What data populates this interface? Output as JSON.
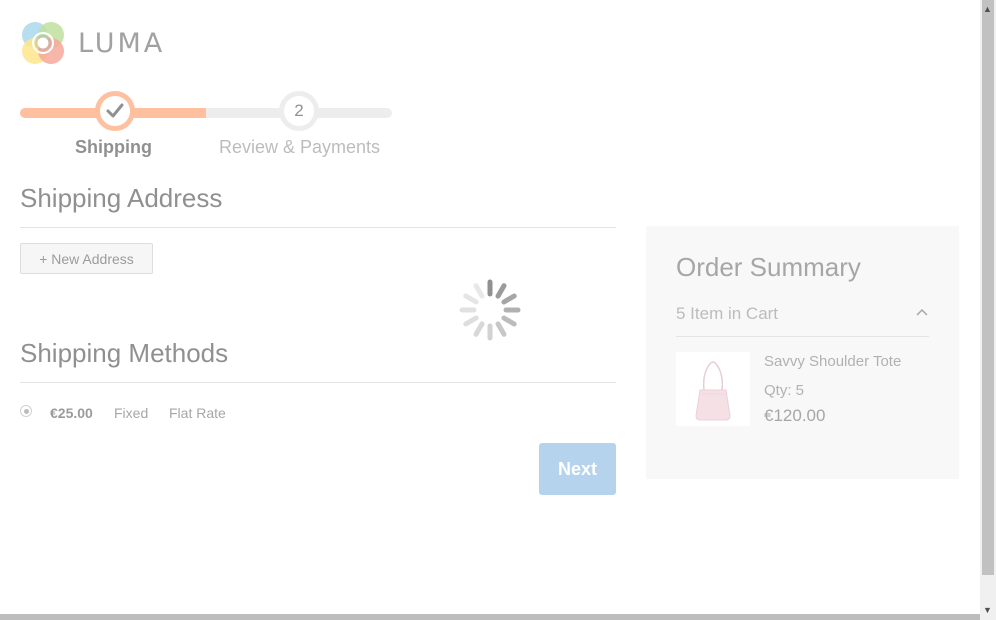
{
  "brand": {
    "name": "LUMA"
  },
  "progress": {
    "steps": [
      {
        "label": "Shipping",
        "state": "complete"
      },
      {
        "number": "2",
        "label": "Review & Payments",
        "state": "pending"
      }
    ],
    "fill_fraction": 0.5,
    "accent_color": "#ff9f6e"
  },
  "shipping_address": {
    "title": "Shipping Address",
    "new_address_label": "+ New Address"
  },
  "shipping_methods": {
    "title": "Shipping Methods",
    "rows": [
      {
        "price": "€25.00",
        "method": "Fixed",
        "carrier": "Flat Rate",
        "selected": true
      }
    ]
  },
  "actions": {
    "next_label": "Next",
    "next_color": "#8fbce4"
  },
  "loading": true,
  "order_summary": {
    "title": "Order Summary",
    "items_in_cart": "5 Item in Cart",
    "items": [
      {
        "name": "Savvy Shoulder Tote",
        "qty": "Qty: 5",
        "price": "€120.00",
        "image": "pink-shoulder-tote"
      }
    ]
  }
}
